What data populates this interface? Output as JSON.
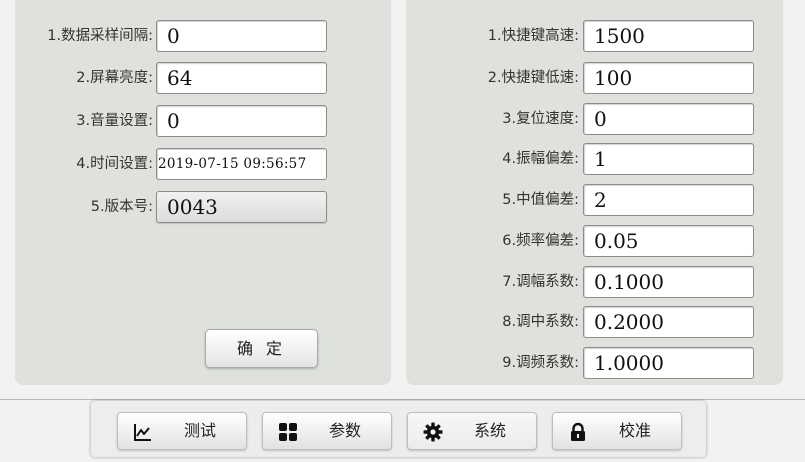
{
  "left_panel": {
    "rows": [
      {
        "label": "1.数据采样间隔:",
        "value": "0"
      },
      {
        "label": "2.屏幕亮度:",
        "value": "64"
      },
      {
        "label": "3.音量设置:",
        "value": "0"
      },
      {
        "label": "4.时间设置:",
        "value": "2019-07-15 09:56:57"
      },
      {
        "label": "5.版本号:",
        "value": "0043"
      }
    ],
    "confirm_label": "确 定"
  },
  "right_panel": {
    "rows": [
      {
        "label": "1.快捷键高速:",
        "value": "1500"
      },
      {
        "label": "2.快捷键低速:",
        "value": "100"
      },
      {
        "label": "3.复位速度:",
        "value": "0"
      },
      {
        "label": "4.振幅偏差:",
        "value": "1"
      },
      {
        "label": "5.中值偏差:",
        "value": "2"
      },
      {
        "label": "6.频率偏差:",
        "value": "0.05"
      },
      {
        "label": "7.调幅系数:",
        "value": "0.1000"
      },
      {
        "label": "8.调中系数:",
        "value": "0.2000"
      },
      {
        "label": "9.调频系数:",
        "value": "1.0000"
      }
    ]
  },
  "nav": {
    "active": "system",
    "items": [
      {
        "label": "测试",
        "icon": "line-chart-icon"
      },
      {
        "label": "参数",
        "icon": "grid-icon"
      },
      {
        "label": "系统",
        "icon": "gear-icon"
      },
      {
        "label": "校准",
        "icon": "lock-icon"
      }
    ]
  }
}
